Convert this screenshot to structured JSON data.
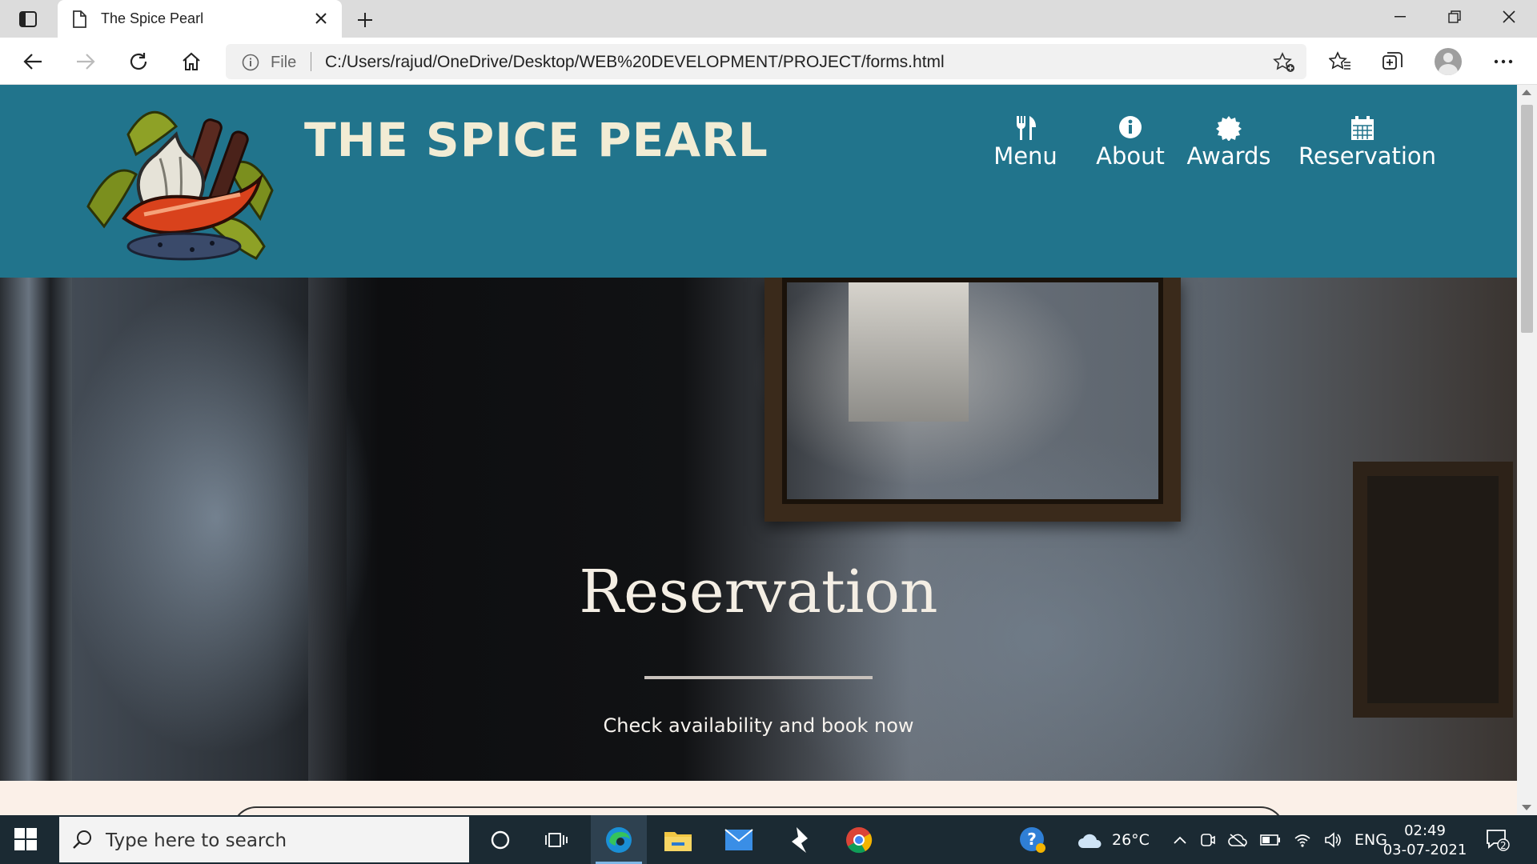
{
  "browser": {
    "tab_title": "The Spice Pearl",
    "address_scheme": "File",
    "url": "C:/Users/rajud/OneDrive/Desktop/WEB%20DEVELOPMENT/PROJECT/forms.html"
  },
  "site": {
    "brand": "THE SPICE PEARL",
    "nav": [
      {
        "label": "Menu",
        "icon": "fork-knife-icon"
      },
      {
        "label": "About",
        "icon": "info-circle-icon"
      },
      {
        "label": "Awards",
        "icon": "certificate-icon"
      },
      {
        "label": "Reservation",
        "icon": "calendar-icon"
      }
    ],
    "header_color": "#21748c",
    "brand_color": "#f2ecd4"
  },
  "hero": {
    "title": "Reservation",
    "subtitle": "Check availability and book now"
  },
  "taskbar": {
    "search_placeholder": "Type here to search",
    "weather": "26°C",
    "language": "ENG",
    "time": "02:49",
    "date": "03-07-2021",
    "notification_count": "2"
  }
}
